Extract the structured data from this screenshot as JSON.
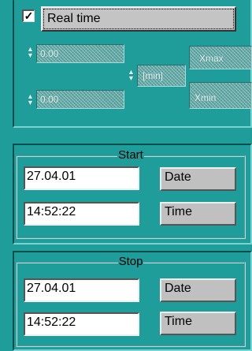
{
  "realtime": {
    "label": "Real time",
    "checked": "✓"
  },
  "scale": {
    "value1": "0.00",
    "value2": "0.00",
    "unit": "[min]",
    "max_label": "Xmax",
    "min_label": "Xmin",
    "spin_up": "▲",
    "spin_down": "▼"
  },
  "start": {
    "title": "Start",
    "date_value": "27.04.01",
    "time_value": "14:52:22",
    "date_button": "Date",
    "time_button": "Time"
  },
  "stop": {
    "title": "Stop",
    "date_value": "27.04.01",
    "time_value": "14:52:22",
    "date_button": "Date",
    "time_button": "Time"
  }
}
